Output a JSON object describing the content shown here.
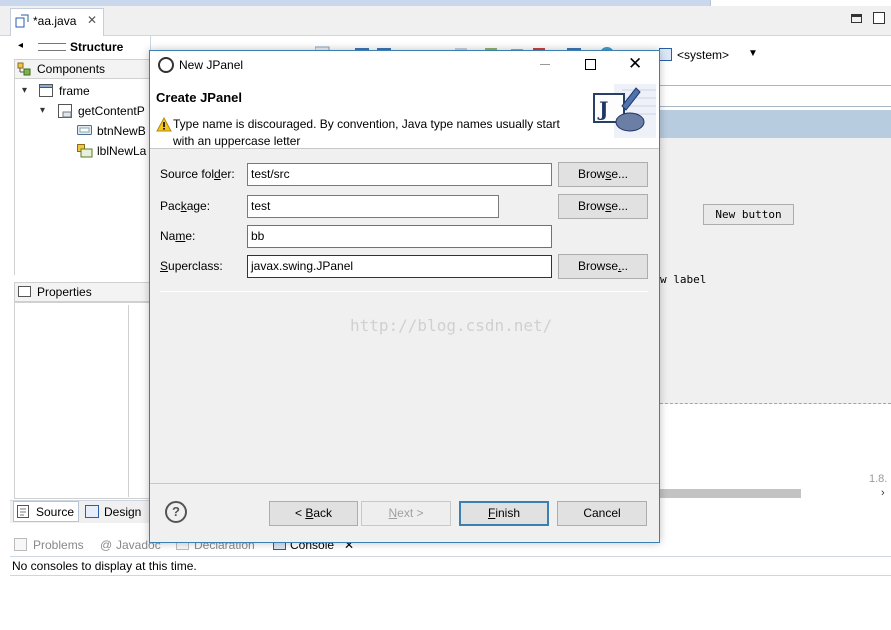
{
  "editor": {
    "tab_label": "*aa.java",
    "tab_close": "✕"
  },
  "structure": {
    "title": "Structure",
    "components_title": "Components",
    "tree": [
      {
        "label": "frame"
      },
      {
        "label": "getContentP"
      },
      {
        "label": "btnNewB"
      },
      {
        "label": "lblNewLa"
      }
    ],
    "properties_title": "Properties"
  },
  "bottom_tabs": {
    "source": "Source",
    "design": "Design"
  },
  "canvas": {
    "system_label": "<system>",
    "button_text": "New button",
    "label_text": "w label",
    "version": "1.8.",
    "scroll_arrow": "›"
  },
  "console": {
    "tabs": [
      "Problems",
      "Javadoc",
      "Declaration",
      "Console"
    ],
    "message": "No consoles to display at this time."
  },
  "dialog": {
    "window_title": "New JPanel",
    "close_glyph": "✕",
    "header_title": "Create JPanel",
    "warning": "Type name is discouraged. By convention, Java type names usually start with an uppercase letter",
    "fields": {
      "source_folder": {
        "label_pre": "Source fol",
        "label_mn": "d",
        "label_post": "er:",
        "value": "test/src"
      },
      "package": {
        "label_pre": "Pac",
        "label_mn": "k",
        "label_post": "age:",
        "value": "test"
      },
      "name": {
        "label_pre": "Na",
        "label_mn": "m",
        "label_post": "e:",
        "value": "bb"
      },
      "superclass": {
        "label_pre": "",
        "label_mn": "S",
        "label_post": "uperclass:",
        "value": "javax.swing.JPanel"
      }
    },
    "browse": {
      "pre": "Brow",
      "mn": "s",
      "post": "e..."
    },
    "browse3": {
      "pre": "Browse",
      "mn": ".",
      "post": ".."
    },
    "watermark": "http://blog.csdn.net/",
    "buttons": {
      "help": "?",
      "back_pre": "< ",
      "back_mn": "B",
      "back_post": "ack",
      "next_pre": "",
      "next_mn": "N",
      "next_post": "ext >",
      "finish_pre": "",
      "finish_mn": "F",
      "finish_post": "inish",
      "cancel": "Cancel"
    }
  },
  "colors": {
    "accent": "#3c7fb1",
    "canvas_band": "#b8cce0",
    "warning": "#f5c518"
  }
}
